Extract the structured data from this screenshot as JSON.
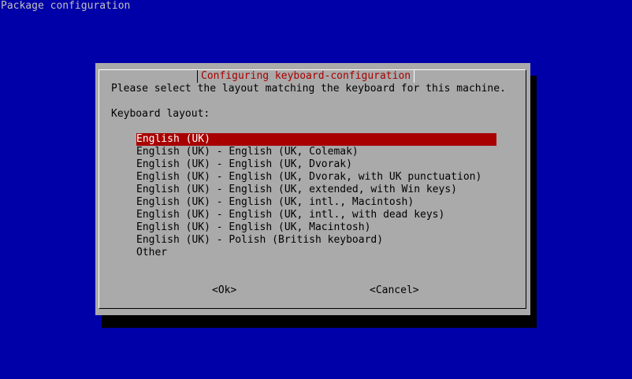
{
  "screen": {
    "title": "Package configuration"
  },
  "dialog": {
    "title": "Configuring keyboard-configuration",
    "prompt": "Please select the layout matching the keyboard for this machine.",
    "field_label": "Keyboard layout:",
    "selected_index": 0,
    "options": [
      "English (UK)",
      "English (UK) - English (UK, Colemak)",
      "English (UK) - English (UK, Dvorak)",
      "English (UK) - English (UK, Dvorak, with UK punctuation)",
      "English (UK) - English (UK, extended, with Win keys)",
      "English (UK) - English (UK, intl., Macintosh)",
      "English (UK) - English (UK, intl., with dead keys)",
      "English (UK) - English (UK, Macintosh)",
      "English (UK) - Polish (British keyboard)",
      "Other"
    ],
    "ok_label": "<Ok>",
    "cancel_label": "<Cancel>"
  },
  "colors": {
    "screen_background": "#0000a8",
    "dialog_background": "#aaaaaa",
    "title_text": "#a80000",
    "selection_background": "#a80000",
    "selection_text": "#ffffff"
  }
}
